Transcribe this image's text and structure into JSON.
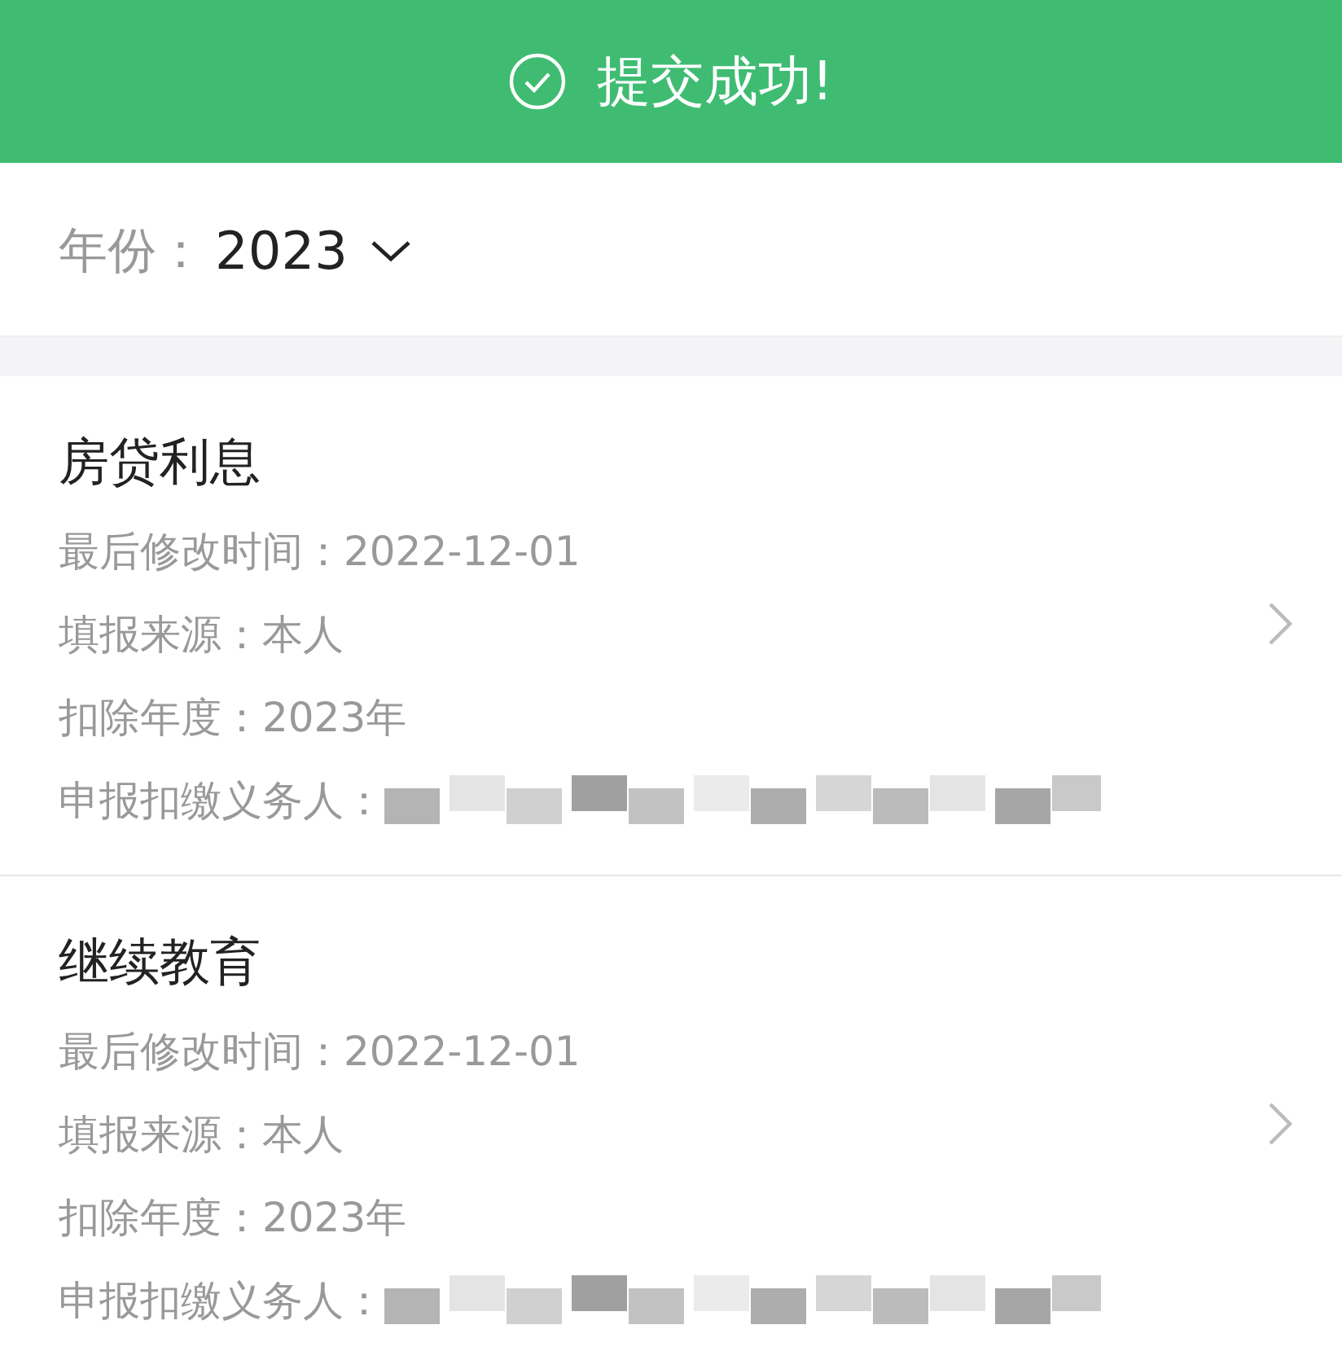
{
  "banner": {
    "message": "提交成功!"
  },
  "year_filter": {
    "label": "年份：",
    "value": "2023"
  },
  "records": [
    {
      "title": "房贷利息",
      "fields": [
        {
          "label": "最后修改时间：",
          "value": "2022-12-01"
        },
        {
          "label": "填报来源：",
          "value": "本人"
        },
        {
          "label": "扣除年度：",
          "value": "2023年"
        },
        {
          "label": "申报扣缴义务人：",
          "redacted": true
        }
      ]
    },
    {
      "title": "继续教育",
      "fields": [
        {
          "label": "最后修改时间：",
          "value": "2022-12-01"
        },
        {
          "label": "填报来源：",
          "value": "本人"
        },
        {
          "label": "扣除年度：",
          "value": "2023年"
        },
        {
          "label": "申报扣缴义务人：",
          "redacted": true
        }
      ]
    }
  ]
}
